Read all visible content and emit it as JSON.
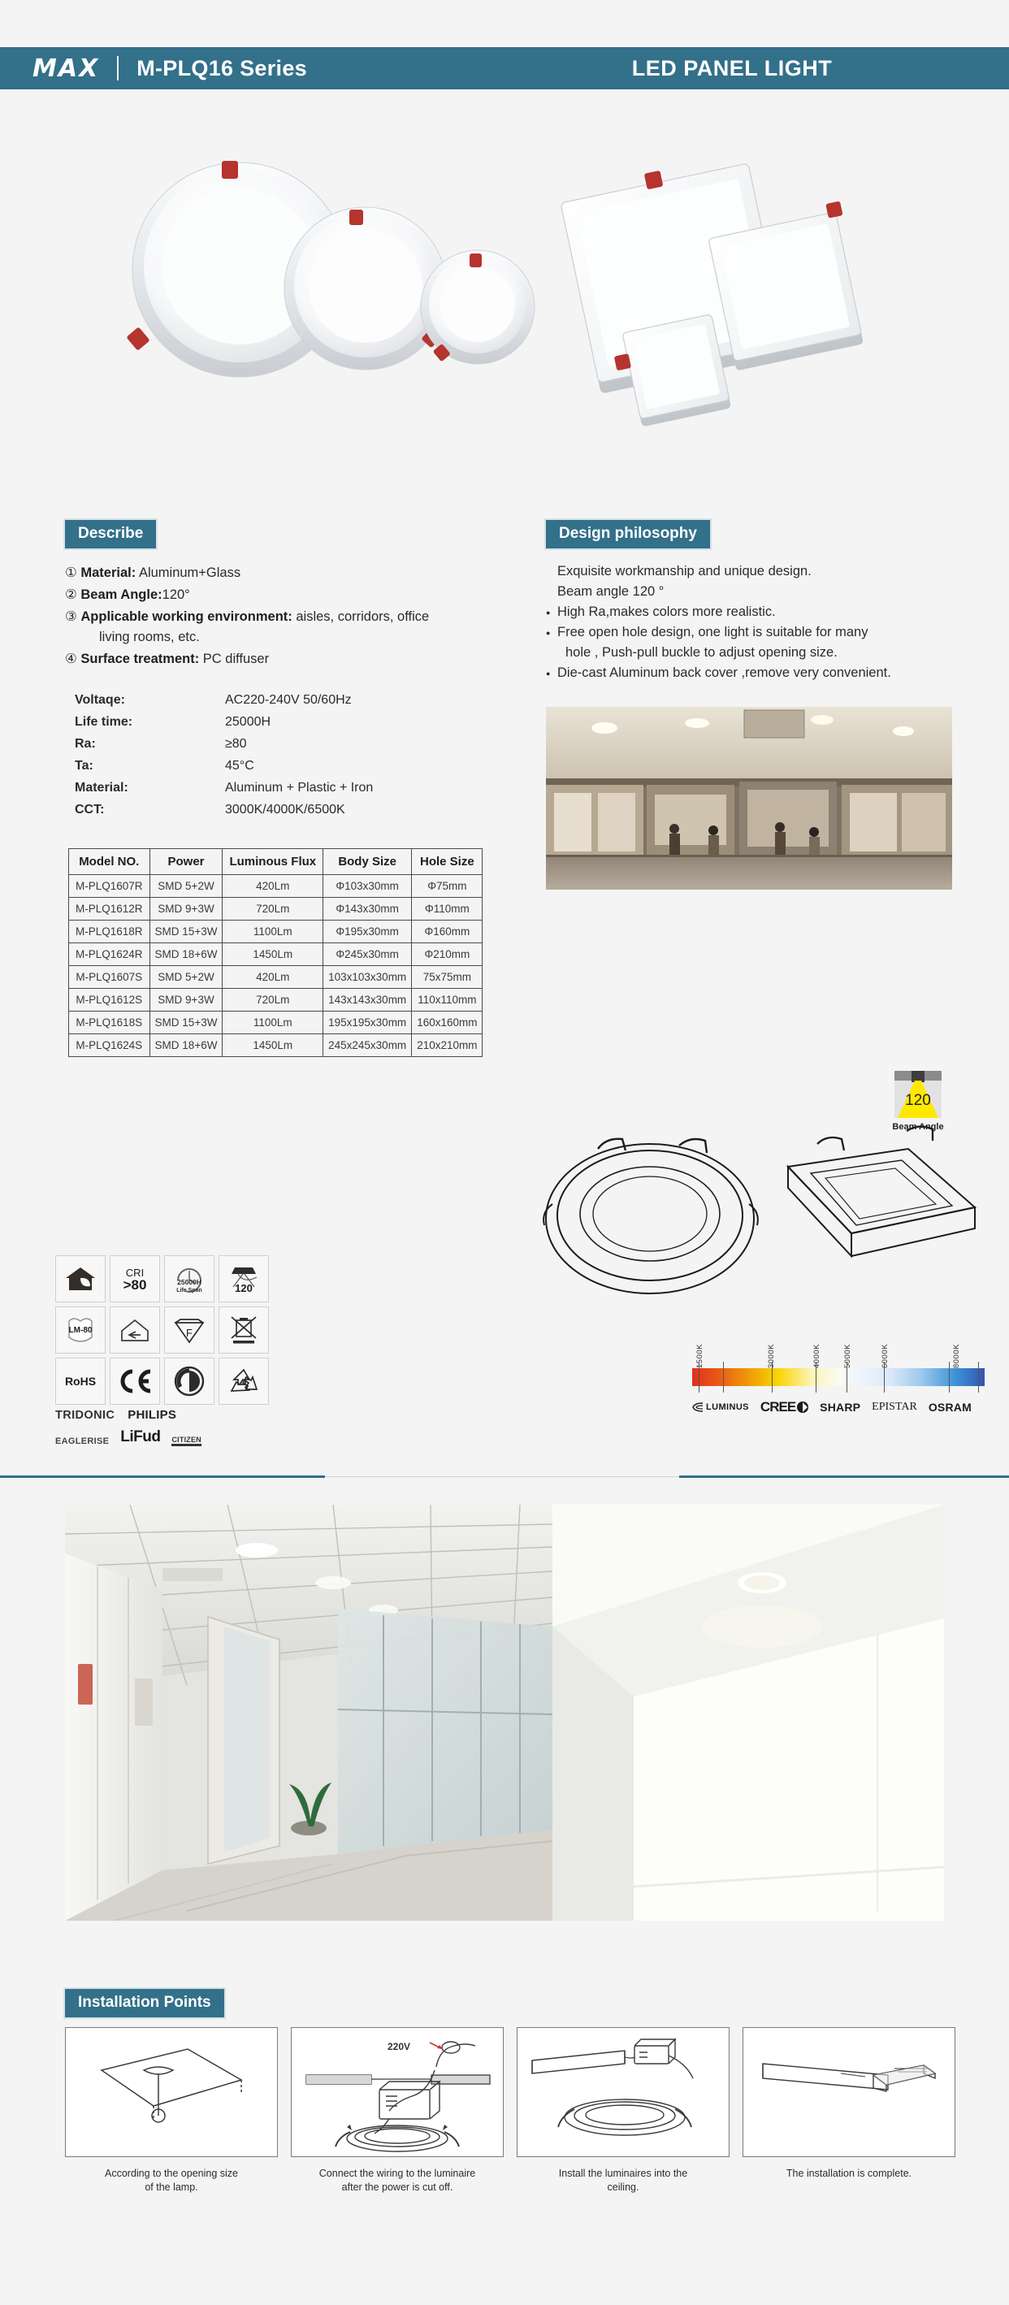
{
  "header": {
    "brand": "MAX",
    "series": "M-PLQ16 Series",
    "product_type": "LED PANEL LIGHT",
    "accent_color": "#33708a"
  },
  "describe": {
    "tag": "Describe",
    "items": [
      {
        "num": "①",
        "label": "Material:",
        "value": "Aluminum+Glass"
      },
      {
        "num": "②",
        "label": "Beam Angle:",
        "value": "120°"
      },
      {
        "num": "③",
        "label": "Applicable working environment:",
        "value": "aisles, corridors, office",
        "cont": "living rooms, etc."
      },
      {
        "num": "④",
        "label": "Surface treatment:",
        "value": "PC diffuser"
      }
    ]
  },
  "specs": [
    {
      "key": "Voltaqe:",
      "val": "AC220-240V 50/60Hz"
    },
    {
      "key": "Life time:",
      "val": "25000H"
    },
    {
      "key": "Ra:",
      "val": "≥80"
    },
    {
      "key": "Ta:",
      "val": "45°C"
    },
    {
      "key": "Material:",
      "val": "Aluminum + Plastic + Iron"
    },
    {
      "key": "CCT:",
      "val": "3000K/4000K/6500K"
    }
  ],
  "model_table": {
    "headers": [
      "Model NO.",
      "Power",
      "Luminous Flux",
      "Body Size",
      "Hole Size"
    ],
    "rows": [
      [
        "M-PLQ1607R",
        "SMD 5+2W",
        "420Lm",
        "Φ103x30mm",
        "Φ75mm"
      ],
      [
        "M-PLQ1612R",
        "SMD 9+3W",
        "720Lm",
        "Φ143x30mm",
        "Φ110mm"
      ],
      [
        "M-PLQ1618R",
        "SMD 15+3W",
        "1100Lm",
        "Φ195x30mm",
        "Φ160mm"
      ],
      [
        "M-PLQ1624R",
        "SMD 18+6W",
        "1450Lm",
        "Φ245x30mm",
        "Φ210mm"
      ],
      [
        "M-PLQ1607S",
        "SMD 5+2W",
        "420Lm",
        "103x103x30mm",
        "75x75mm"
      ],
      [
        "M-PLQ1612S",
        "SMD 9+3W",
        "720Lm",
        "143x143x30mm",
        "110x110mm"
      ],
      [
        "M-PLQ1618S",
        "SMD 15+3W",
        "1100Lm",
        "195x195x30mm",
        "160x160mm"
      ],
      [
        "M-PLQ1624S",
        "SMD 18+6W",
        "1450Lm",
        "245x245x30mm",
        "210x210mm"
      ]
    ]
  },
  "philosophy": {
    "tag": "Design philosophy",
    "plain_lines": [
      "Exquisite workmanship and unique design.",
      "Beam angle 120 °"
    ],
    "bullets": [
      {
        "text": "High Ra,makes colors more realistic."
      },
      {
        "text": "Free open hole design, one light is suitable for many",
        "cont": "hole , Push-pull buckle to adjust opening size."
      },
      {
        "text": "Die-cast Aluminum back cover ,remove very convenient."
      }
    ]
  },
  "beam_badge": {
    "value": "120",
    "degree": "°",
    "label": "Beam Angle"
  },
  "certifications": [
    {
      "name": "eco-house-icon",
      "type": "icon",
      "text": ""
    },
    {
      "name": "cri-icon",
      "type": "text",
      "line1": "CRI",
      "line2": ">80"
    },
    {
      "name": "life-span-icon",
      "type": "icon",
      "text": "25000H",
      "sub": "Life Span"
    },
    {
      "name": "beam-angle-120-icon",
      "type": "icon",
      "text": "120"
    },
    {
      "name": "lm-80-icon",
      "type": "icon",
      "text": "LM-80"
    },
    {
      "name": "indoor-use-icon",
      "type": "icon",
      "text": ""
    },
    {
      "name": "f-mark-icon",
      "type": "icon",
      "text": "F"
    },
    {
      "name": "weee-bin-icon",
      "type": "icon",
      "text": ""
    },
    {
      "name": "rohs-icon",
      "type": "text",
      "line1": "RoHS",
      "line2": ""
    },
    {
      "name": "ce-mark-icon",
      "type": "icon",
      "text": "CE"
    },
    {
      "name": "green-dot-icon",
      "type": "icon",
      "text": ""
    },
    {
      "name": "recycle-icon",
      "type": "icon",
      "text": ""
    }
  ],
  "driver_brands": [
    "TRIDONIC",
    "PHILIPS",
    "EAGLERISE",
    "LiFud",
    "CITIZEN"
  ],
  "cct_scale": {
    "ticks": [
      "1500K",
      "3000K",
      "4000K",
      "5000K",
      "6000K",
      "8000K"
    ],
    "tick_positions": [
      3,
      33,
      58,
      74,
      94,
      140
    ]
  },
  "led_brands": [
    "LUMINUS",
    "CREE",
    "SHARP",
    "EPISTAR",
    "OSRAM"
  ],
  "installation": {
    "tag": "Installation Points",
    "voltage_label": "220V",
    "steps": [
      {
        "caption_line1": "According to the opening size",
        "caption_line2": "of the lamp."
      },
      {
        "caption_line1": "Connect the wiring to the luminaire",
        "caption_line2": "after the power is cut off."
      },
      {
        "caption_line1": "Install the luminaires into the",
        "caption_line2": "ceiling."
      },
      {
        "caption_line1": "The installation is complete.",
        "caption_line2": ""
      }
    ]
  }
}
